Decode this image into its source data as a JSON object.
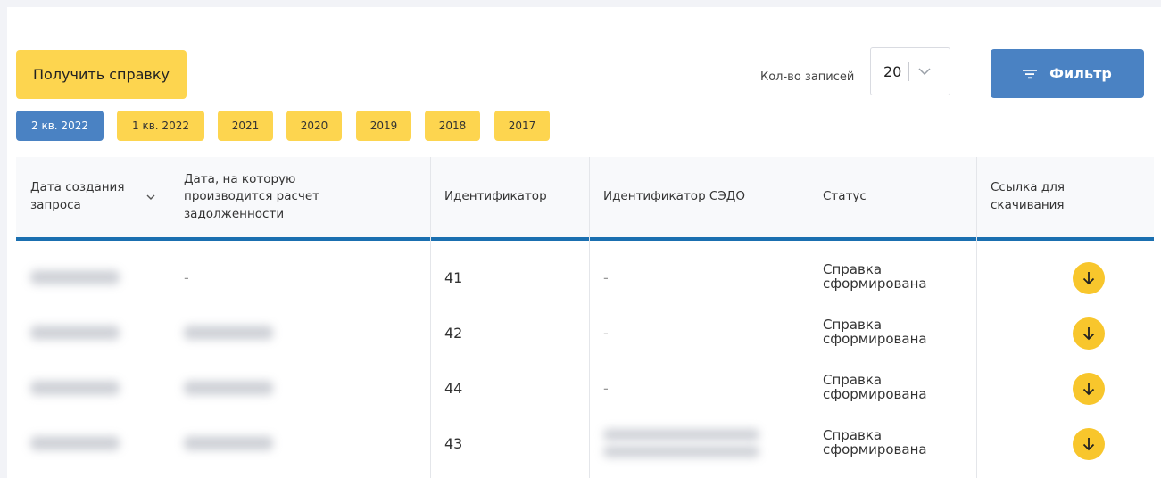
{
  "toolbar": {
    "get_report_label": "Получить справку",
    "records_label": "Кол-во записей",
    "records_value": "20",
    "filter_label": "Фильтр"
  },
  "periods": [
    {
      "label": "2 кв. 2022",
      "active": true
    },
    {
      "label": "1 кв. 2022",
      "active": false
    },
    {
      "label": "2021",
      "active": false
    },
    {
      "label": "2020",
      "active": false
    },
    {
      "label": "2019",
      "active": false
    },
    {
      "label": "2018",
      "active": false
    },
    {
      "label": "2017",
      "active": false
    }
  ],
  "table": {
    "columns": {
      "created": "Дата создания запроса",
      "calc_date": "Дата, на которую производится расчет задолженности",
      "id": "Идентификатор",
      "sedo_id": "Идентификатор СЭДО",
      "status": "Статус",
      "download": "Ссылка для скачивания"
    },
    "rows": [
      {
        "created": "",
        "calc_date": "-",
        "id": "41",
        "sedo_id": "-",
        "status": "Справка сформирована"
      },
      {
        "created": "",
        "calc_date": "",
        "id": "42",
        "sedo_id": "-",
        "status": "Справка сформирована"
      },
      {
        "created": "",
        "calc_date": "",
        "id": "44",
        "sedo_id": "-",
        "status": "Справка сформирована"
      },
      {
        "created": "",
        "calc_date": "",
        "id": "43",
        "sedo_id": "",
        "status": "Справка сформирована"
      }
    ]
  },
  "colors": {
    "accent_yellow": "#fdd54f",
    "accent_blue": "#4a82c3",
    "header_underline": "#1a6fb0",
    "download_circle": "#f8c62c"
  },
  "icons": {
    "filter": "filter-lines-icon",
    "records_dropdown": "chevron-down-icon",
    "sort": "chevron-down-icon",
    "download": "arrow-down-icon"
  }
}
